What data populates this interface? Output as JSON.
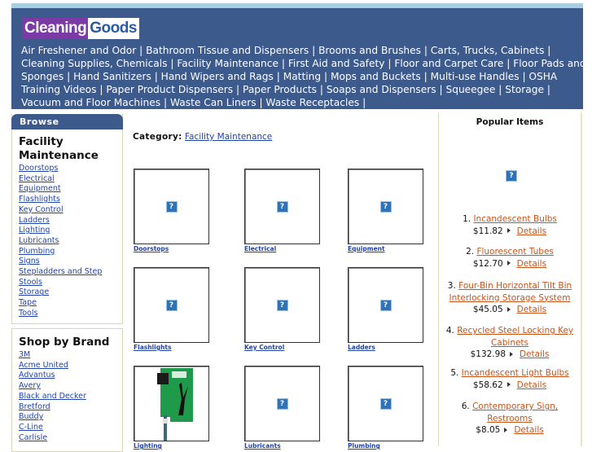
{
  "header": {
    "logo": {
      "part1": "Cleaning",
      "part2": "Goods"
    },
    "categories": [
      "Air Freshener and Odor",
      "Bathroom Tissue and Dispensers",
      "Brooms and Brushes",
      "Carts, Trucks, Cabinets",
      "Cleaning Supplies, Chemicals",
      "Facility Maintenance",
      "First Aid and Safety",
      "Floor and Carpet Care",
      "Floor Pads and Sponges",
      "Hand Sanitizers",
      "Hand Wipers and Rags",
      "Matting",
      "Mops and Buckets",
      "Multi-use Handles",
      "OSHA Training Videos",
      "Paper Product Dispensers",
      "Paper Products",
      "Soaps and Dispensers",
      "Squeegee",
      "Storage",
      "Vacuum and Floor Machines",
      "Waste Can Liners",
      "Waste Receptacles"
    ],
    "separator": "|"
  },
  "sidebar": {
    "browse": {
      "heading": "Browse",
      "title": "Facility Maintenance",
      "links": [
        "Doorstops",
        "Electrical",
        "Equipment",
        "Flashlights",
        "Key Control",
        "Ladders",
        "Lighting",
        "Lubricants",
        "Plumbing",
        "Signs",
        "Stepladders and Step",
        "Stools",
        "Storage",
        "Tape",
        "Tools"
      ]
    },
    "brands": {
      "title": "Shop by Brand",
      "links": [
        "3M",
        "Acme United",
        "Advantus",
        "Avery",
        "Black and Decker",
        "Bretford",
        "Buddy",
        "C-Line",
        "Carlisle"
      ]
    }
  },
  "main": {
    "category_label": "Category:",
    "category_value": "Facility Maintenance",
    "tiles": [
      {
        "caption": "Doorstops",
        "image": "broken-image"
      },
      {
        "caption": "Electrical",
        "image": "broken-image"
      },
      {
        "caption": "Equipment",
        "image": "broken-image"
      },
      {
        "caption": "Flashlights",
        "image": "broken-image"
      },
      {
        "caption": "Key Control",
        "image": "broken-image"
      },
      {
        "caption": "Ladders",
        "image": "broken-image"
      },
      {
        "caption": "Lighting",
        "image": "product-photo"
      },
      {
        "caption": "Lubricants",
        "image": "broken-image"
      },
      {
        "caption": "Plumbing",
        "image": "broken-image"
      }
    ],
    "placeholder_glyph": "?"
  },
  "popular": {
    "title": "Popular Items",
    "placeholder_glyph": "?",
    "details_label": "Details",
    "items": [
      {
        "rank": "1.",
        "name": "Incandescent Bulbs",
        "price": "$11.82"
      },
      {
        "rank": "2.",
        "name": "Fluorescent Tubes",
        "price": "$12.70"
      },
      {
        "rank": "3.",
        "name": "Four-Bin Horizontal Tilt Bin Interlocking Storage System",
        "price": "$45.05"
      },
      {
        "rank": "4.",
        "name": "Recycled Steel Locking Key Cabinets",
        "price": "$132.98"
      },
      {
        "rank": "5.",
        "name": "Incandescent Light Bulbs",
        "price": "$58.62"
      },
      {
        "rank": "6.",
        "name": "Contemporary Sign, Restrooms",
        "price": "$8.05"
      }
    ]
  },
  "colors": {
    "header_bg": "#3d5a8c",
    "link_blue": "#2244aa",
    "link_orange": "#c8541c",
    "logo_purple": "#7b3aa6"
  }
}
